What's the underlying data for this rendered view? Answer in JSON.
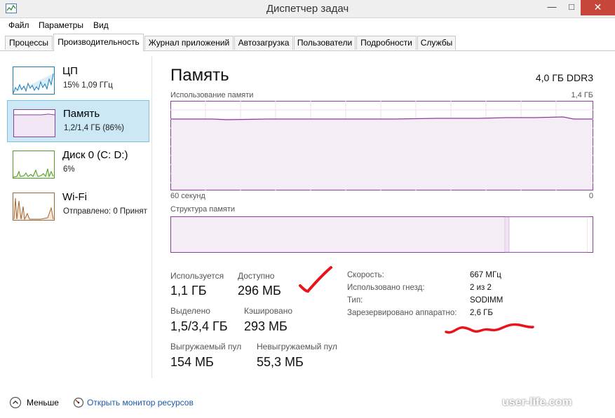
{
  "window": {
    "title": "Диспетчер задач",
    "min": "—",
    "max": "□",
    "close": "✕"
  },
  "menu": [
    "Файл",
    "Параметры",
    "Вид"
  ],
  "tabs": [
    "Процессы",
    "Производительность",
    "Журнал приложений",
    "Автозагрузка",
    "Пользователи",
    "Подробности",
    "Службы"
  ],
  "sidebar": [
    {
      "name": "ЦП",
      "sub": "15% 1,09 ГГц"
    },
    {
      "name": "Память",
      "sub": "1,2/1,4 ГБ (86%)"
    },
    {
      "name": "Диск 0 (C: D:)",
      "sub": "6%"
    },
    {
      "name": "Wi-Fi",
      "sub": "Отправлено: 0 Принят"
    }
  ],
  "main": {
    "title": "Память",
    "spec": "4,0 ГБ DDR3",
    "usage_label": "Использование памяти",
    "usage_max": "1,4 ГБ",
    "time_label": "60 секунд",
    "time_end": "0",
    "structure_label": "Структура памяти"
  },
  "stats": {
    "in_use_label": "Используется",
    "in_use": "1,1 ГБ",
    "available_label": "Доступно",
    "available": "296 МБ",
    "committed_label": "Выделено",
    "committed": "1,5/3,4 ГБ",
    "cached_label": "Кэшировано",
    "cached": "293 МБ",
    "paged_label": "Выгружаемый пул",
    "paged": "154 МБ",
    "nonpaged_label": "Невыгружаемый пул",
    "nonpaged": "55,3 МБ"
  },
  "details": {
    "speed_label": "Скорость:",
    "speed": "667 МГц",
    "slots_label": "Использовано гнезд:",
    "slots": "2 из 2",
    "type_label": "Тип:",
    "type": "SODIMM",
    "reserved_label": "Зарезервировано аппаратно:",
    "reserved": "2,6 ГБ"
  },
  "footer": {
    "fewer": "Меньше",
    "monitor": "Открыть монитор ресурсов"
  },
  "watermark": "user-life.com",
  "colors": {
    "accent": "#8b3d9e",
    "selection": "#cce8f4",
    "link": "#1a5aa8",
    "annotation": "#e8131b"
  }
}
